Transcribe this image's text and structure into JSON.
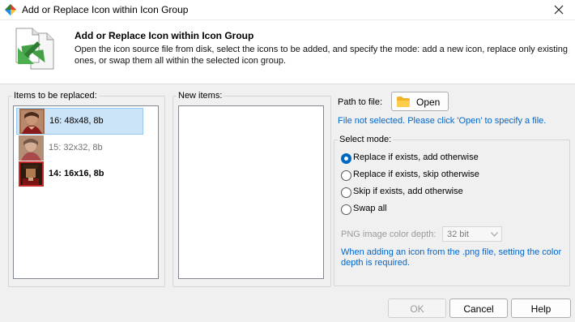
{
  "window": {
    "title": "Add or Replace Icon within Icon Group"
  },
  "header": {
    "title": "Add or Replace Icon within Icon Group",
    "description": "Open the icon source file from disk, select the icons to be added, and specify the mode: add a new icon, replace only existing ones, or swap them all within the selected icon group."
  },
  "replace_panel": {
    "label": "Items to be replaced:",
    "items": [
      {
        "label": "16: 48x48, 8b",
        "state": "selected"
      },
      {
        "label": "15: 32x32, 8b",
        "state": "dimmed"
      },
      {
        "label": "14: 16x16, 8b",
        "state": "bold"
      }
    ]
  },
  "new_panel": {
    "label": "New items:"
  },
  "file": {
    "path_label": "Path to file:",
    "open_label": "Open",
    "status": "File not selected. Please click 'Open' to specify a file."
  },
  "mode": {
    "label": "Select mode:",
    "options": [
      {
        "label": "Replace if exists, add otherwise",
        "checked": true
      },
      {
        "label": "Replace if exists, skip otherwise",
        "checked": false
      },
      {
        "label": "Skip if exists, add otherwise",
        "checked": false
      },
      {
        "label": "Swap all",
        "checked": false
      }
    ],
    "depth_label": "PNG image color depth:",
    "depth_value": "32 bit",
    "depth_note": "When adding an icon from the .png file, setting the color depth is required."
  },
  "buttons": {
    "ok": "OK",
    "cancel": "Cancel",
    "help": "Help"
  },
  "colors": {
    "accent": "#0067c0",
    "link": "#0066cc",
    "selection": "#cce4f7"
  }
}
